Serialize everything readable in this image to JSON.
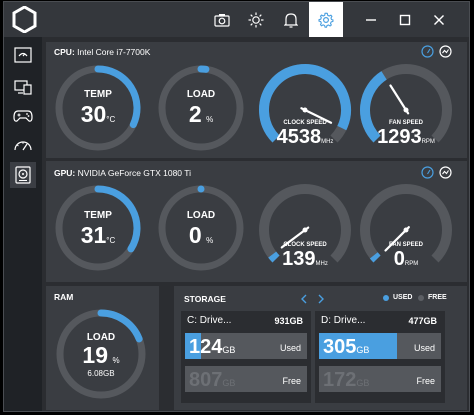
{
  "colors": {
    "accent": "#4a9fe0",
    "panel": "#3a3d42",
    "track": "#55585d"
  },
  "toolbar": {
    "icons": [
      "camera-icon",
      "brightness-icon",
      "bell-icon",
      "settings-icon",
      "minimize-icon",
      "maximize-icon",
      "close-icon"
    ],
    "active": "settings-icon"
  },
  "sidebar": {
    "items": [
      "dashboard-icon",
      "monitor-icon",
      "gamepad-icon",
      "speedometer-icon",
      "storage-drive-icon"
    ],
    "active": "storage-drive-icon"
  },
  "cpu": {
    "label": "CPU:",
    "name": "Intel Core i7-7700K",
    "temp": {
      "label": "TEMP",
      "value": "30",
      "unit": "°C",
      "fraction": 0.32
    },
    "load": {
      "label": "LOAD",
      "value": "2",
      "unit": "%",
      "fraction": 0.02
    },
    "clock": {
      "label": "CLOCK SPEED",
      "value": "4538",
      "unit": "MHz",
      "fraction": 0.93
    },
    "fan": {
      "label": "FAN SPEED",
      "value": "1293",
      "unit": "RPM",
      "fraction": 0.38
    }
  },
  "gpu": {
    "label": "GPU:",
    "name": "NVIDIA GeForce GTX 1080 Ti",
    "temp": {
      "label": "TEMP",
      "value": "31",
      "unit": "°C",
      "fraction": 0.34
    },
    "load": {
      "label": "LOAD",
      "value": "0",
      "unit": "%",
      "fraction": 0.0
    },
    "clock": {
      "label": "CLOCK SPEED",
      "value": "139",
      "unit": "MHz",
      "fraction": 0.03
    },
    "fan": {
      "label": "FAN SPEED",
      "value": "0",
      "unit": "RPM",
      "fraction": 0.0
    }
  },
  "ram": {
    "title": "RAM",
    "label": "LOAD",
    "value": "19",
    "unit": "%",
    "detail": "6.08GB",
    "fraction": 0.19
  },
  "storage": {
    "title": "STORAGE",
    "legend_used": "USED",
    "legend_free": "FREE",
    "drives": [
      {
        "name": "C: Drive...",
        "total": "931GB",
        "used_value": "124",
        "used_unit": "GB",
        "used_label": "Used",
        "free_value": "807",
        "free_unit": "GB",
        "free_label": "Free",
        "used_fraction": 0.13
      },
      {
        "name": "D: Drive...",
        "total": "477GB",
        "used_value": "305",
        "used_unit": "GB",
        "used_label": "Used",
        "free_value": "172",
        "free_unit": "GB",
        "free_label": "Free",
        "used_fraction": 0.64
      }
    ]
  }
}
